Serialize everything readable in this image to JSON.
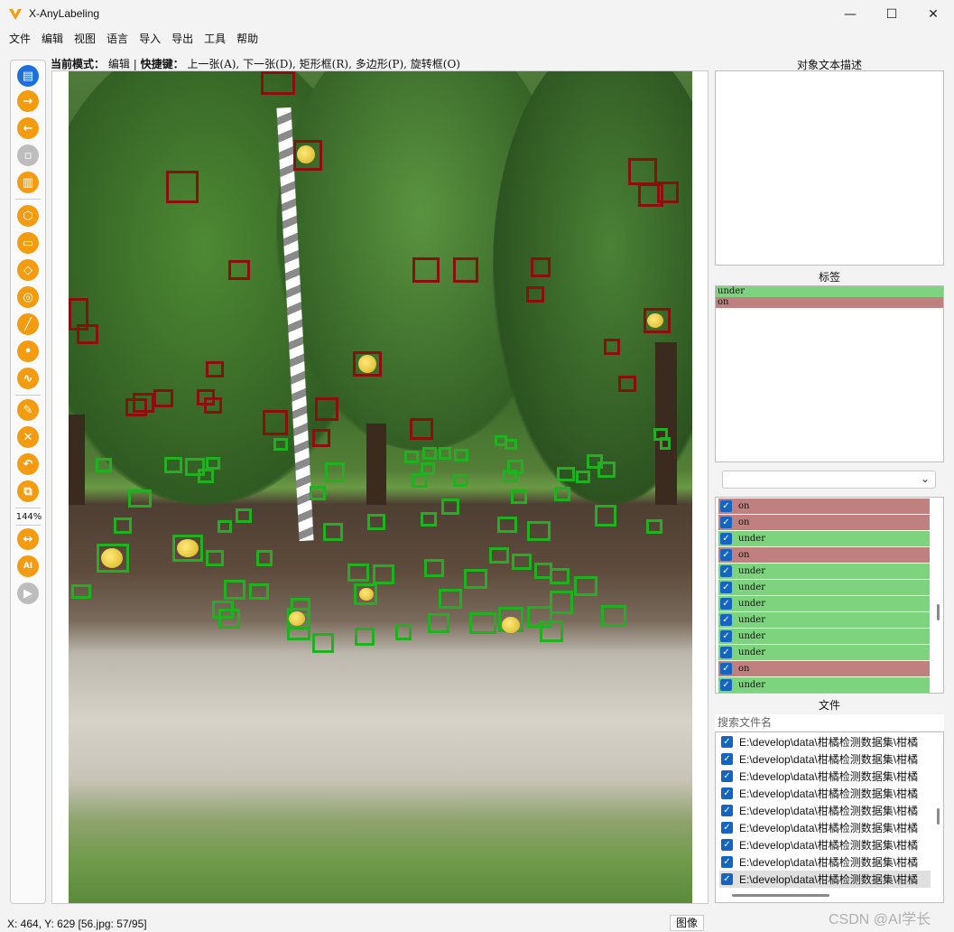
{
  "window": {
    "title": "X-AnyLabeling",
    "minimize": "—",
    "maximize": "☐",
    "close": "✕"
  },
  "menu": [
    "文件",
    "编辑",
    "视图",
    "语言",
    "导入",
    "导出",
    "工具",
    "帮助"
  ],
  "mode_bar": {
    "prefix": "当前模式：",
    "mode": "编辑",
    "sep": "|",
    "shortcut_label": "快捷键：",
    "shortcuts": "上一张(A), 下一张(D), 矩形框(R), 多边形(P), 旋转框(O)"
  },
  "toolbar": {
    "zoom": "144%"
  },
  "panels": {
    "description_title": "对象文本描述",
    "labels_title": "标签",
    "labels": [
      {
        "name": "under",
        "status": "under"
      },
      {
        "name": "on",
        "status": "on"
      }
    ],
    "annotations": [
      "on",
      "on",
      "under",
      "on",
      "under",
      "under",
      "under",
      "under",
      "under",
      "under",
      "on",
      "under"
    ],
    "files_title": "文件",
    "search_placeholder": "搜索文件名",
    "files": [
      "E:\\develop\\data\\柑橘检测数据集\\柑橘",
      "E:\\develop\\data\\柑橘检测数据集\\柑橘",
      "E:\\develop\\data\\柑橘检测数据集\\柑橘",
      "E:\\develop\\data\\柑橘检测数据集\\柑橘",
      "E:\\develop\\data\\柑橘检测数据集\\柑橘",
      "E:\\develop\\data\\柑橘检测数据集\\柑橘",
      "E:\\develop\\data\\柑橘检测数据集\\柑橘",
      "E:\\develop\\data\\柑橘检测数据集\\柑橘",
      "E:\\develop\\data\\柑橘检测数据集\\柑橘"
    ]
  },
  "status": {
    "text": "X: 464, Y: 629 [56.jpg: 57/95]",
    "image_tab": "图像"
  },
  "watermark": "CSDN @AI学长",
  "colors": {
    "on": "#8a1010",
    "under": "#20b020",
    "accent": "#f39c12"
  }
}
